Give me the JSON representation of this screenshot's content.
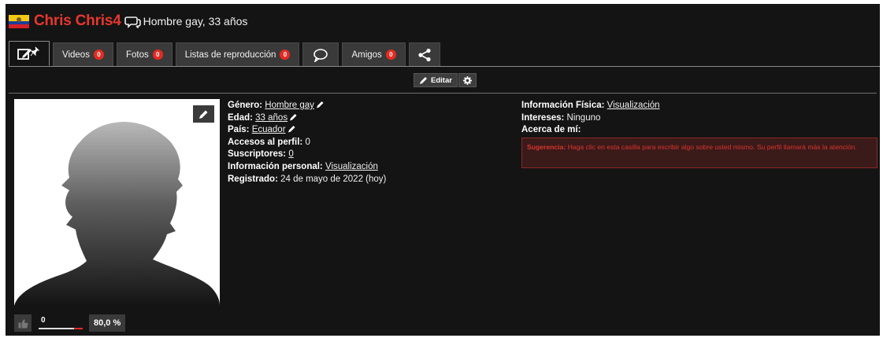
{
  "header": {
    "username": "Chris Chris4",
    "subtitle": "Hombre gay, 33 años",
    "flag_country": "Ecuador"
  },
  "tabs": [
    {
      "label": "",
      "icon": "edit-pin-icon",
      "active": true
    },
    {
      "label": "Videos",
      "badge": "0"
    },
    {
      "label": "Fotos",
      "badge": "0"
    },
    {
      "label": "Listas de reproducción",
      "badge": "0"
    },
    {
      "label": "",
      "icon": "chat-bubble-icon"
    },
    {
      "label": "Amigos",
      "badge": "0"
    },
    {
      "label": "",
      "icon": "share-icon"
    }
  ],
  "editbar": {
    "edit_label": "Editar",
    "settings_icon": "gear-icon"
  },
  "profile": {
    "gender_label": "Género:",
    "gender_value": "Hombre gay",
    "age_label": "Edad:",
    "age_value": "33 años",
    "country_label": "País:",
    "country_value": "Ecuador",
    "views_label": "Accesos al perfil:",
    "views_value": "0",
    "subscribers_label": "Suscriptores:",
    "subscribers_value": "0",
    "personal_label": "Información personal:",
    "personal_value": "Visualización",
    "registered_label": "Registrado:",
    "registered_value": "24 de mayo de 2022 (hoy)",
    "physical_label": "Información Física:",
    "physical_value": "Visualización",
    "interests_label": "Intereses:",
    "interests_value": "Ninguno",
    "about_label": "Acerca de mí:"
  },
  "tip": {
    "label": "Sugerencia:",
    "text": "Haga clic en esta casilla para escribir algo sobre usted mismo. Su perfil llamará más la atención."
  },
  "rating": {
    "likes": "0",
    "percent": "80,0 %",
    "fraction": 0.8
  },
  "colors": {
    "accent": "#e8362c",
    "panel": "#141414",
    "badge": "#e52b22"
  }
}
